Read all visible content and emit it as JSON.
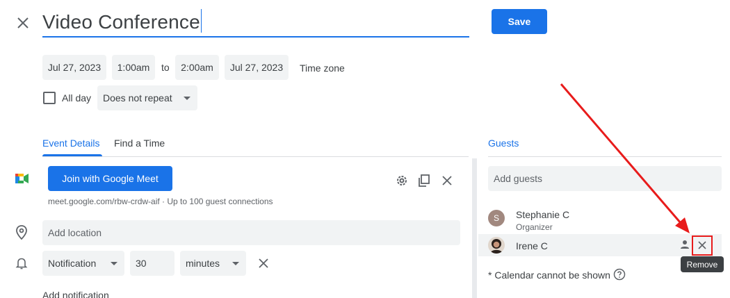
{
  "header": {
    "close_icon": "close-icon",
    "title": "Video Conference",
    "save_label": "Save"
  },
  "datetime": {
    "start_date": "Jul 27, 2023",
    "start_time": "1:00am",
    "to_label": "to",
    "end_time": "2:00am",
    "end_date": "Jul 27, 2023",
    "time_zone_label": "Time zone",
    "all_day_label": "All day",
    "repeat_value": "Does not repeat"
  },
  "tabs": {
    "event_details": "Event Details",
    "find_a_time": "Find a Time"
  },
  "meet": {
    "join_label": "Join with Google Meet",
    "link_info": "meet.google.com/rbw-crdw-aif · Up to 100 guest connections"
  },
  "location": {
    "placeholder": "Add location"
  },
  "notification": {
    "type": "Notification",
    "amount": "30",
    "unit": "minutes",
    "add_label": "Add notification"
  },
  "guests": {
    "tab_label": "Guests",
    "add_placeholder": "Add guests",
    "list": [
      {
        "initial": "S",
        "name": "Stephanie C",
        "role": "Organizer"
      },
      {
        "name": "Irene C"
      }
    ],
    "remove_tooltip": "Remove",
    "calendar_note": "* Calendar cannot be shown"
  },
  "colors": {
    "accent": "#1a73e8",
    "annotation": "#e81b1b"
  }
}
